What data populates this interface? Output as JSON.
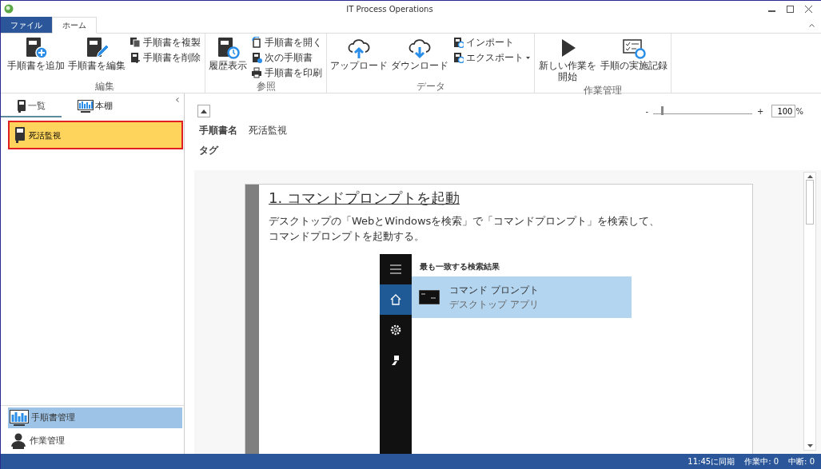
{
  "window": {
    "title": "IT Process Operations"
  },
  "ribbon_tabs": [
    {
      "label": "ファイル",
      "kind": "file",
      "selected": false
    },
    {
      "label": "ホーム",
      "kind": "tab",
      "selected": true
    }
  ],
  "ribbon_groups": [
    {
      "label": "編集",
      "items": [
        {
          "label": "手順書を追加",
          "kind": "large"
        },
        {
          "label": "手順書を編集",
          "kind": "large"
        },
        {
          "label": "手順書を複製",
          "kind": "small"
        },
        {
          "label": "手順書を削除",
          "kind": "small"
        }
      ]
    },
    {
      "label": "参照",
      "items": [
        {
          "label": "履歴表示",
          "kind": "large"
        },
        {
          "label": "手順書を開く",
          "kind": "small"
        },
        {
          "label": "次の手順書",
          "kind": "small"
        },
        {
          "label": "手順書を印刷",
          "kind": "small"
        }
      ]
    },
    {
      "label": "データ",
      "items": [
        {
          "label": "アップロード",
          "kind": "large"
        },
        {
          "label": "ダウンロード",
          "kind": "large"
        },
        {
          "label": "インポート",
          "kind": "small"
        },
        {
          "label": "エクスポート",
          "kind": "small",
          "dropdown": true
        }
      ]
    },
    {
      "label": "作業管理",
      "items": [
        {
          "label": "新しい作業を開始",
          "kind": "large"
        },
        {
          "label": "手順の実施記録",
          "kind": "large"
        }
      ]
    }
  ],
  "panel_tabs": [
    {
      "label": "一覧",
      "selected": true
    },
    {
      "label": "本棚",
      "selected": false
    }
  ],
  "procedures": [
    {
      "label": "死活監視",
      "selected": true
    }
  ],
  "nav": [
    {
      "label": "手順書管理",
      "selected": true
    },
    {
      "label": "作業管理",
      "selected": false
    }
  ],
  "zoom": {
    "minus": "-",
    "plus": "+",
    "level": 0.08,
    "value": "100",
    "unit": "%"
  },
  "fields": [
    {
      "label": "手順書名",
      "value": "死活監視"
    },
    {
      "label": "タグ"
    }
  ],
  "document": {
    "heading": "1. コマンドプロンプトを起動",
    "body_lines": [
      "デスクトップの「WebとWindowsを検索」で「コマンドプロンプト」を検索して、",
      "コマンドプロンプトを起動する。"
    ],
    "screenshot": {
      "header": "最も一致する検索結果",
      "sidebar": [
        {
          "kind": "menu",
          "selected": false
        },
        {
          "kind": "home",
          "selected": true
        },
        {
          "kind": "settings",
          "selected": false
        },
        {
          "kind": "user",
          "selected": false
        }
      ],
      "result": {
        "title": "コマンド プロンプト",
        "subtitle": "デスクトップ アプリ",
        "selected": true
      }
    }
  },
  "status_bar": {
    "items": [
      "11:45に同期",
      "作業中: 0",
      "中断: 0"
    ]
  }
}
